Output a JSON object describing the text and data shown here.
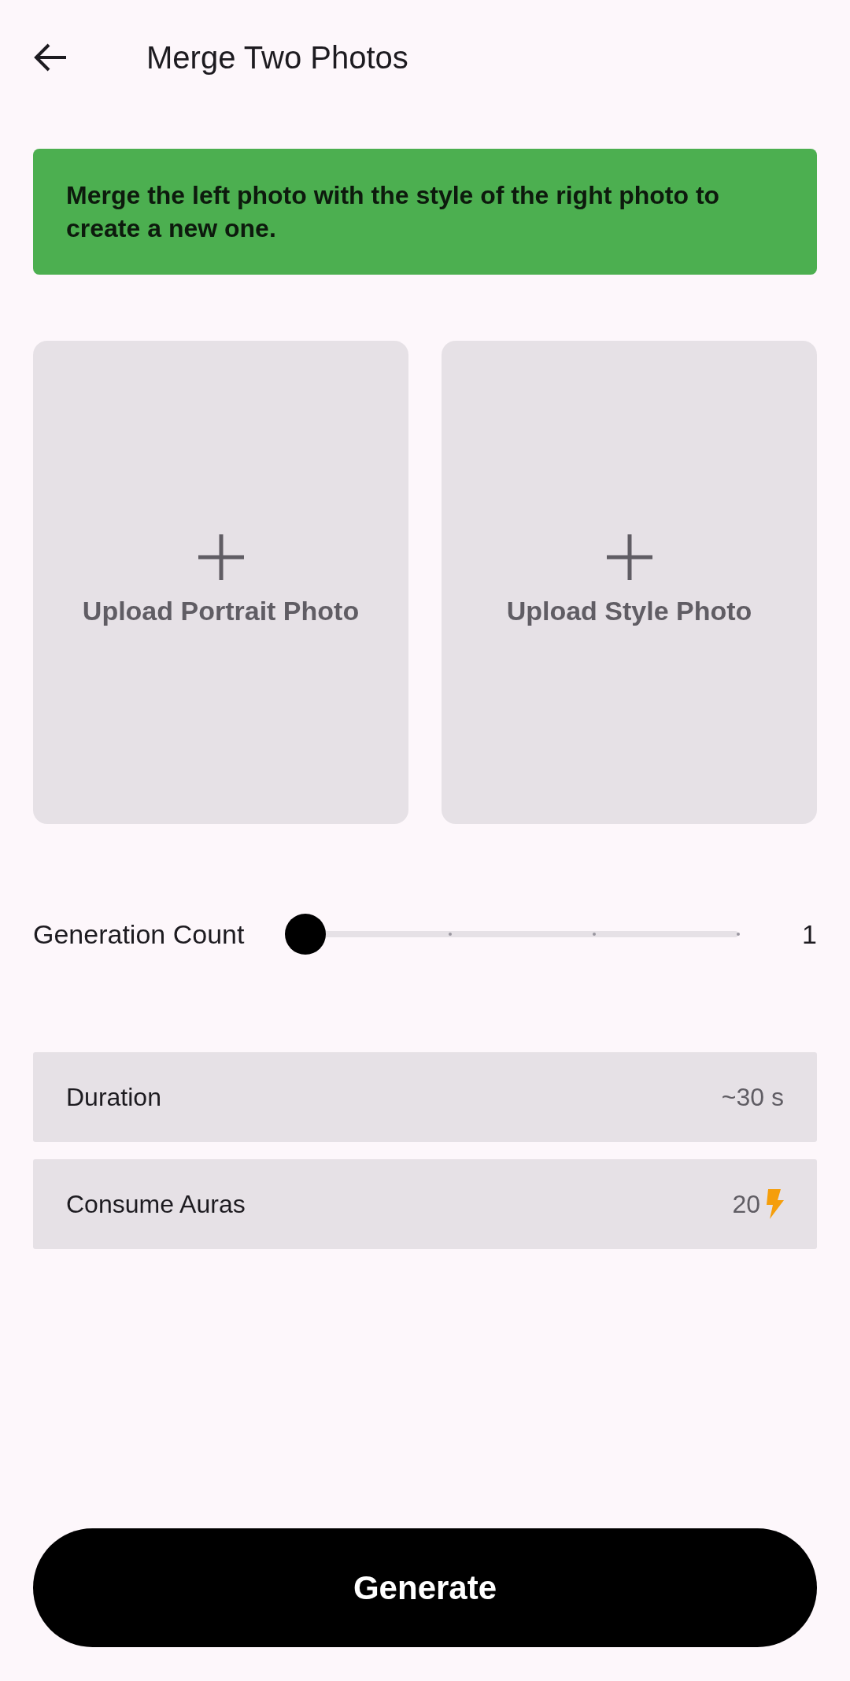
{
  "app_bar": {
    "title": "Merge Two Photos"
  },
  "banner": {
    "text": "Merge the left photo with the style of the right photo to create a new one."
  },
  "uploads": [
    {
      "label": "Upload Portrait Photo"
    },
    {
      "label": "Upload Style Photo"
    }
  ],
  "slider": {
    "label": "Generation Count",
    "level": 0,
    "reading": "1"
  },
  "info_rows": [
    {
      "kind": "text",
      "label": "Duration",
      "value": "~30 s"
    },
    {
      "kind": "auras",
      "label": "Consume Auras",
      "value": "20"
    }
  ],
  "button": {
    "label": "Generate"
  }
}
